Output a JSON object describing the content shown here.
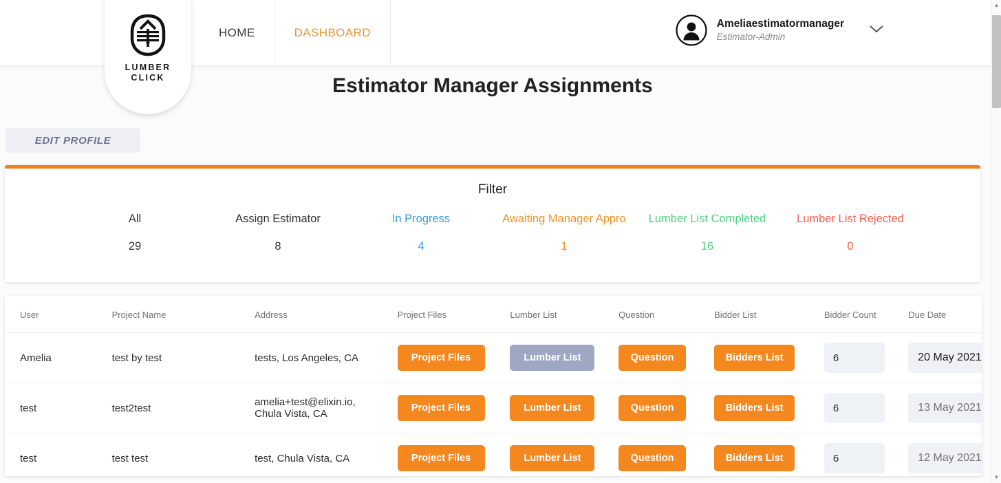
{
  "navbar": {
    "logo": {
      "line1": "LUMBER",
      "line2": "CLICK",
      "icon": "lumber-shield-logo"
    },
    "links": [
      {
        "label": "HOME",
        "active": false
      },
      {
        "label": "DASHBOARD",
        "active": true
      }
    ],
    "user": {
      "name": "Ameliaestimatormanager",
      "role": "Estimator-Admin",
      "avatar_icon": "user-avatar-icon",
      "chevron_icon": "chevron-down-icon"
    }
  },
  "page": {
    "title": "Estimator Manager Assignments",
    "edit_profile_label": "EDIT PROFILE"
  },
  "filter": {
    "title": "Filter",
    "items": [
      {
        "label": "All",
        "count": "29",
        "color": "#333333"
      },
      {
        "label": "Assign Estimator",
        "count": "8",
        "color": "#333333"
      },
      {
        "label": "In Progress",
        "count": "4",
        "color": "#2e9bf0"
      },
      {
        "label": "Awaiting Manager Appro",
        "count": "1",
        "color": "#f0921e"
      },
      {
        "label": "Lumber List Completed",
        "count": "16",
        "color": "#4cd080"
      },
      {
        "label": "Lumber List Rejected",
        "count": "0",
        "color": "#f4604f"
      }
    ]
  },
  "table": {
    "headers": [
      "User",
      "Project Name",
      "Address",
      "Project Files",
      "Lumber List",
      "Question",
      "Bidder List",
      "Bidder Count",
      "Due Date"
    ],
    "rows": [
      {
        "user": "Amelia",
        "project_name": "test by test",
        "address": "tests, Los Angeles, CA",
        "project_files_label": "Project Files",
        "lumber_list_label": "Lumber List",
        "lumber_list_state": "disabled",
        "question_label": "Question",
        "bidder_list_label": "Bidders List",
        "bidder_count": "6",
        "due_date": "20 May 2021",
        "due_date_state": "filled"
      },
      {
        "user": "test",
        "project_name": "test2test",
        "address": "amelia+test@elixin.io, Chula Vista, CA",
        "project_files_label": "Project Files",
        "lumber_list_label": "Lumber List",
        "lumber_list_state": "enabled",
        "question_label": "Question",
        "bidder_list_label": "Bidders List",
        "bidder_count": "6",
        "due_date": "13 May 2021",
        "due_date_state": "empty"
      },
      {
        "user": "test",
        "project_name": "test test",
        "address": "test, Chula Vista, CA",
        "project_files_label": "Project Files",
        "lumber_list_label": "Lumber List",
        "lumber_list_state": "enabled",
        "question_label": "Question",
        "bidder_list_label": "Bidders List",
        "bidder_count": "6",
        "due_date": "12 May 2021",
        "due_date_state": "empty"
      }
    ]
  },
  "colors": {
    "accent_orange": "#f0821e",
    "button_orange": "#f5871f",
    "button_disabled": "#9ea7c4",
    "field_gray": "#eef1f6"
  }
}
